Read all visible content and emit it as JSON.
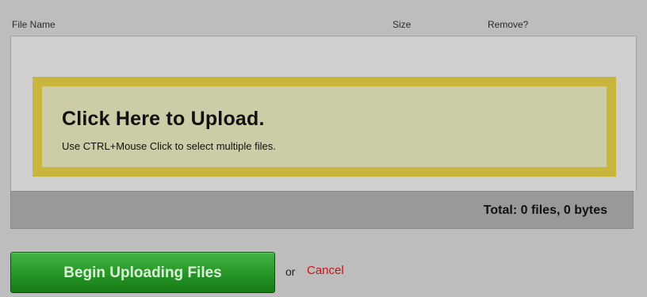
{
  "table": {
    "headers": {
      "file_name": "File Name",
      "size": "Size",
      "remove": "Remove?"
    }
  },
  "dropzone": {
    "title": "Click Here to Upload.",
    "hint": "Use CTRL+Mouse Click to select multiple files."
  },
  "summary": {
    "total": "Total: 0 files, 0 bytes"
  },
  "actions": {
    "begin_label": "Begin Uploading Files",
    "or_text": "or",
    "cancel_label": "Cancel"
  },
  "colors": {
    "dropzone_border": "#c9b53b",
    "dropzone_fill": "#cccca6",
    "begin_green": "#2b9a2b",
    "cancel_red": "#cc1111"
  }
}
